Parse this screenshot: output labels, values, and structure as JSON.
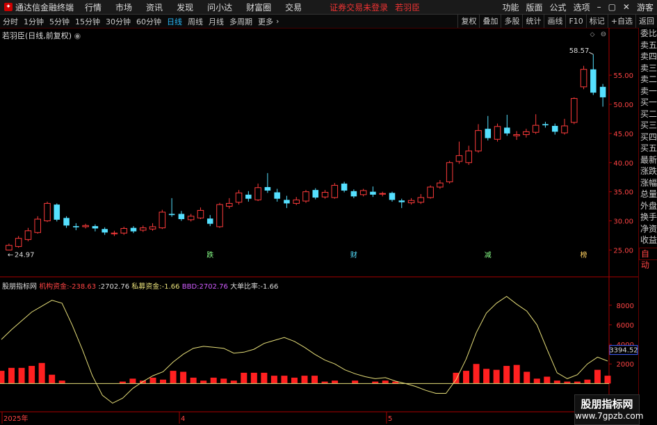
{
  "app": {
    "title": "通达信金融终端",
    "notice": "证券交易未登录",
    "notice_user": "若羽臣"
  },
  "menu": [
    "行情",
    "市场",
    "资讯",
    "发现",
    "问小达",
    "财富圈",
    "交易"
  ],
  "right_menu": [
    "功能",
    "版面",
    "公式",
    "选项",
    "游客"
  ],
  "periods": [
    "分时",
    "1分钟",
    "5分钟",
    "15分钟",
    "30分钟",
    "60分钟",
    "日线",
    "周线",
    "月线",
    "多周期",
    "更多"
  ],
  "active_period": "日线",
  "tools": [
    "复权",
    "叠加",
    "多股",
    "统计",
    "画线",
    "F10",
    "标记",
    "+自选",
    "返回"
  ],
  "subtitle": "若羽臣(日线,前复权)",
  "sidebar": [
    "委比",
    "卖五",
    "卖四",
    "卖三",
    "卖二",
    "卖一",
    "买一",
    "买二",
    "买三",
    "买四",
    "买五",
    "最新",
    "涨跌",
    "涨幅",
    "总量",
    "外盘",
    "换手",
    "净资",
    "收益"
  ],
  "sidebar_auto": "自动",
  "indicator": {
    "name": "股朋指标网",
    "l1": "机构资金:",
    "v1": "-238.63",
    "l2": "2702.76",
    "l3": "私募资金:",
    "v3": "-1.66",
    "l4": "BBD:",
    "v4": "2702.76",
    "l5": "大单比率:",
    "v5": "-1.66"
  },
  "watermark": {
    "line1": "股朋指标网",
    "line2": "www.7gpzb.com"
  },
  "markers": [
    "跌",
    "财",
    "减",
    "榜"
  ],
  "colors": {
    "up": "#ff3b3b",
    "down": "#55e0ff",
    "line": "#e8e07a",
    "axis": "#aa0000"
  },
  "chart_data": [
    {
      "type": "candlestick",
      "title": "",
      "ylim": [
        23.5,
        60.5
      ],
      "yticks": [
        25,
        30,
        35,
        40,
        45,
        50,
        55
      ],
      "y_labels": [
        "25.00",
        "30.00",
        "35.00",
        "40.00",
        "45.00",
        "50.00",
        "55.00"
      ],
      "annotations": {
        "high": "58.57",
        "low": "24.97"
      },
      "candles": [
        {
          "o": 25.0,
          "c": 25.8,
          "h": 26.1,
          "l": 24.97
        },
        {
          "o": 25.6,
          "c": 27.0,
          "h": 27.4,
          "l": 25.4
        },
        {
          "o": 26.8,
          "c": 28.3,
          "h": 28.8,
          "l": 26.5
        },
        {
          "o": 28.0,
          "c": 30.3,
          "h": 30.8,
          "l": 27.8
        },
        {
          "o": 30.0,
          "c": 33.0,
          "h": 33.3,
          "l": 29.8
        },
        {
          "o": 32.8,
          "c": 30.2,
          "h": 33.0,
          "l": 29.9
        },
        {
          "o": 30.5,
          "c": 29.2,
          "h": 30.8,
          "l": 28.8
        },
        {
          "o": 29.1,
          "c": 28.9,
          "h": 29.6,
          "l": 28.4
        },
        {
          "o": 29.0,
          "c": 29.2,
          "h": 29.5,
          "l": 28.7
        },
        {
          "o": 29.1,
          "c": 28.7,
          "h": 29.4,
          "l": 28.2
        },
        {
          "o": 28.6,
          "c": 28.0,
          "h": 28.9,
          "l": 27.6
        },
        {
          "o": 27.8,
          "c": 27.9,
          "h": 28.3,
          "l": 27.4
        },
        {
          "o": 27.9,
          "c": 28.7,
          "h": 29.0,
          "l": 27.6
        },
        {
          "o": 28.8,
          "c": 28.2,
          "h": 29.1,
          "l": 27.9
        },
        {
          "o": 28.4,
          "c": 28.8,
          "h": 29.2,
          "l": 28.1
        },
        {
          "o": 28.6,
          "c": 29.0,
          "h": 29.6,
          "l": 28.3
        },
        {
          "o": 28.8,
          "c": 31.5,
          "h": 31.9,
          "l": 28.6
        },
        {
          "o": 31.2,
          "c": 31.0,
          "h": 33.9,
          "l": 30.7
        },
        {
          "o": 31.2,
          "c": 30.3,
          "h": 31.7,
          "l": 30.0
        },
        {
          "o": 30.2,
          "c": 30.8,
          "h": 31.2,
          "l": 29.9
        },
        {
          "o": 30.5,
          "c": 31.8,
          "h": 32.3,
          "l": 30.3
        },
        {
          "o": 30.4,
          "c": 29.5,
          "h": 31.0,
          "l": 29.1
        },
        {
          "o": 29.0,
          "c": 32.8,
          "h": 33.1,
          "l": 28.8
        },
        {
          "o": 32.5,
          "c": 33.0,
          "h": 33.9,
          "l": 32.1
        },
        {
          "o": 33.2,
          "c": 34.8,
          "h": 35.3,
          "l": 32.8
        },
        {
          "o": 34.5,
          "c": 33.8,
          "h": 35.1,
          "l": 33.3
        },
        {
          "o": 33.6,
          "c": 35.7,
          "h": 36.4,
          "l": 33.4
        },
        {
          "o": 35.8,
          "c": 35.2,
          "h": 38.2,
          "l": 34.8
        },
        {
          "o": 34.9,
          "c": 33.8,
          "h": 35.5,
          "l": 33.3
        },
        {
          "o": 33.6,
          "c": 33.0,
          "h": 34.3,
          "l": 32.2
        },
        {
          "o": 33.0,
          "c": 33.6,
          "h": 34.1,
          "l": 32.7
        },
        {
          "o": 33.4,
          "c": 35.0,
          "h": 35.3,
          "l": 33.1
        },
        {
          "o": 35.3,
          "c": 34.0,
          "h": 35.6,
          "l": 33.7
        },
        {
          "o": 34.1,
          "c": 34.9,
          "h": 35.3,
          "l": 33.8
        },
        {
          "o": 34.0,
          "c": 36.1,
          "h": 36.5,
          "l": 33.8
        },
        {
          "o": 36.4,
          "c": 35.2,
          "h": 36.7,
          "l": 34.9
        },
        {
          "o": 35.1,
          "c": 34.2,
          "h": 35.4,
          "l": 33.9
        },
        {
          "o": 34.5,
          "c": 35.2,
          "h": 35.5,
          "l": 34.2
        },
        {
          "o": 35.0,
          "c": 34.5,
          "h": 35.9,
          "l": 34.1
        },
        {
          "o": 34.6,
          "c": 34.7,
          "h": 35.0,
          "l": 34.2
        },
        {
          "o": 34.8,
          "c": 33.6,
          "h": 35.0,
          "l": 33.3
        },
        {
          "o": 33.5,
          "c": 33.2,
          "h": 33.8,
          "l": 32.2
        },
        {
          "o": 33.1,
          "c": 33.5,
          "h": 33.9,
          "l": 32.8
        },
        {
          "o": 33.2,
          "c": 34.0,
          "h": 34.6,
          "l": 32.9
        },
        {
          "o": 34.0,
          "c": 35.8,
          "h": 36.1,
          "l": 33.8
        },
        {
          "o": 35.8,
          "c": 36.5,
          "h": 37.0,
          "l": 35.5
        },
        {
          "o": 36.7,
          "c": 40.0,
          "h": 40.3,
          "l": 36.4
        },
        {
          "o": 40.2,
          "c": 41.2,
          "h": 43.6,
          "l": 39.8
        },
        {
          "o": 40.0,
          "c": 42.0,
          "h": 42.9,
          "l": 39.6
        },
        {
          "o": 42.0,
          "c": 45.5,
          "h": 46.6,
          "l": 41.7
        },
        {
          "o": 45.8,
          "c": 44.2,
          "h": 48.0,
          "l": 43.8
        },
        {
          "o": 44.0,
          "c": 46.2,
          "h": 46.7,
          "l": 43.6
        },
        {
          "o": 46.0,
          "c": 45.0,
          "h": 48.2,
          "l": 44.6
        },
        {
          "o": 44.6,
          "c": 44.8,
          "h": 45.4,
          "l": 43.9
        },
        {
          "o": 44.8,
          "c": 45.3,
          "h": 45.8,
          "l": 44.3
        },
        {
          "o": 45.2,
          "c": 46.4,
          "h": 48.3,
          "l": 44.9
        },
        {
          "o": 46.6,
          "c": 46.4,
          "h": 47.0,
          "l": 46.0
        },
        {
          "o": 46.3,
          "c": 45.3,
          "h": 46.7,
          "l": 44.8
        },
        {
          "o": 45.1,
          "c": 46.3,
          "h": 47.5,
          "l": 44.8
        },
        {
          "o": 46.9,
          "c": 51.0,
          "h": 51.2,
          "l": 46.6
        },
        {
          "o": 53.0,
          "c": 56.0,
          "h": 56.6,
          "l": 52.6
        },
        {
          "o": 56.0,
          "c": 52.0,
          "h": 58.57,
          "l": 51.6
        },
        {
          "o": 53.0,
          "c": 51.2,
          "h": 53.5,
          "l": 49.6
        }
      ]
    },
    {
      "type": "line_bar",
      "title": "",
      "ylim": [
        -2600,
        9900
      ],
      "yticks": [
        2000,
        4000,
        6000,
        8000
      ],
      "y_labels": [
        "2000",
        "4000",
        "6000",
        "8000"
      ],
      "current_label": "3394.52",
      "line": [
        4500,
        5500,
        6400,
        7300,
        7900,
        8500,
        8200,
        6000,
        3500,
        800,
        -1200,
        -2000,
        -1500,
        -500,
        200,
        800,
        1200,
        2200,
        3000,
        3600,
        3800,
        3700,
        3600,
        3100,
        3200,
        3500,
        4100,
        4400,
        4700,
        4300,
        3700,
        3000,
        2400,
        2000,
        1400,
        1000,
        700,
        500,
        600,
        250,
        0,
        -300,
        -700,
        -1000,
        -1000,
        400,
        2500,
        5200,
        7200,
        8200,
        8900,
        8100,
        7400,
        6000,
        3500,
        1100,
        500,
        900,
        2000,
        2700,
        2300
      ],
      "bars": [
        1300,
        1600,
        1600,
        1800,
        2100,
        900,
        300,
        0,
        0,
        0,
        0,
        0,
        200,
        500,
        300,
        600,
        400,
        1300,
        1200,
        600,
        300,
        600,
        500,
        300,
        1100,
        1100,
        1100,
        800,
        800,
        600,
        800,
        800,
        200,
        300,
        0,
        300,
        0,
        200,
        300,
        200,
        0,
        0,
        0,
        0,
        0,
        1100,
        1300,
        2000,
        1500,
        1400,
        1800,
        1900,
        1200,
        500,
        700,
        300,
        200,
        200,
        400,
        1400,
        800
      ]
    }
  ],
  "x_labels": [
    "2025年",
    "4",
    "5"
  ]
}
